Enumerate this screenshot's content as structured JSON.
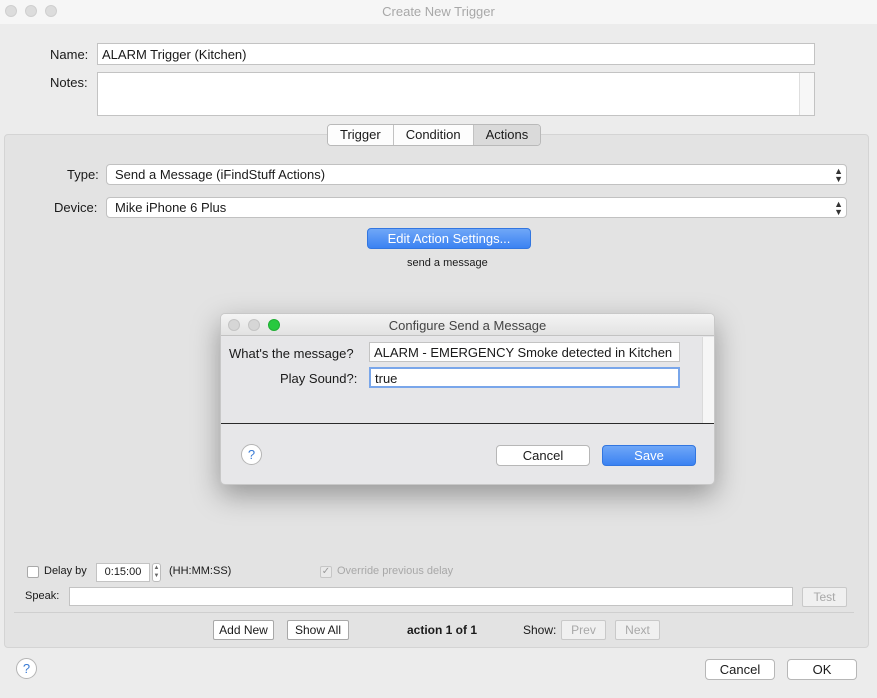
{
  "window": {
    "title": "Create New Trigger"
  },
  "form": {
    "name_label": "Name:",
    "name_value": "ALARM Trigger (Kitchen)",
    "notes_label": "Notes:",
    "notes_value": ""
  },
  "tabs": [
    {
      "label": "Trigger",
      "active": false
    },
    {
      "label": "Condition",
      "active": false
    },
    {
      "label": "Actions",
      "active": true
    }
  ],
  "actions": {
    "type_label": "Type:",
    "type_value": "Send a Message (iFindStuff Actions)",
    "device_label": "Device:",
    "device_value": "Mike iPhone 6 Plus",
    "edit_button": "Edit Action Settings...",
    "description": "send a message"
  },
  "dialog": {
    "title": "Configure Send a Message",
    "message_label": "What's the message?",
    "message_value": "ALARM - EMERGENCY Smoke detected in Kitchen",
    "sound_label": "Play Sound?:",
    "sound_value": "true",
    "help": "?",
    "cancel": "Cancel",
    "save": "Save"
  },
  "delay": {
    "checkbox_label": "Delay by",
    "value": "0:15:00",
    "format": "(HH:MM:SS)",
    "override_label": "Override previous delay",
    "override_checked": true
  },
  "speak": {
    "label": "Speak:",
    "value": "",
    "test_button": "Test"
  },
  "footer_bar": {
    "add_new": "Add New",
    "show_all": "Show All",
    "counter": "action 1 of 1",
    "show_label": "Show:",
    "prev": "Prev",
    "next": "Next"
  },
  "bottom": {
    "help": "?",
    "cancel": "Cancel",
    "ok": "OK"
  },
  "colors": {
    "accent": "#3b82f2",
    "green_button": "#27c93f",
    "help_text": "#3a7bd5"
  }
}
